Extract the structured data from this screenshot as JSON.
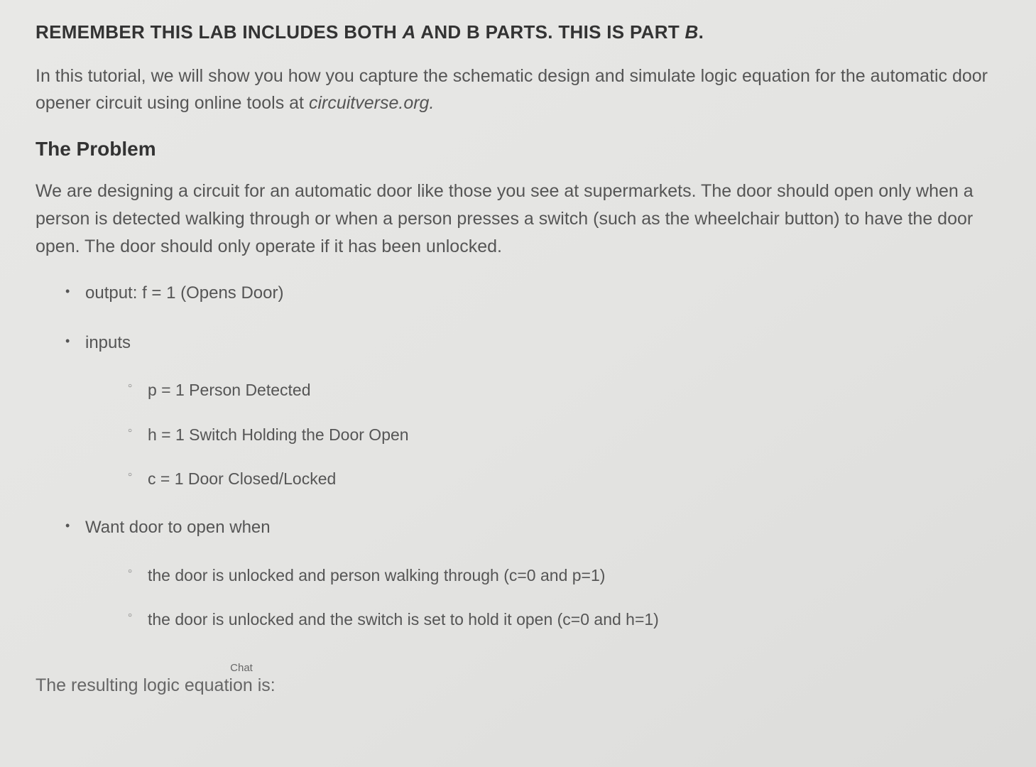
{
  "heading": {
    "prefix": "REMEMBER THIS LAB INCLUDES BOTH ",
    "italic1": "A ",
    "mid": " AND B PARTS. THIS IS PART ",
    "italic2": "B",
    "suffix": "."
  },
  "intro": {
    "text1": "In this tutorial, we will show you how you capture the schematic design and simulate logic equation for the automatic door opener circuit using online tools at ",
    "italic_site": "circuitverse.org.",
    "text2": ""
  },
  "section_title": "The Problem",
  "problem_text": "We are designing a circuit for an automatic door like those you see at supermarkets. The door should open only when a person is detected walking through or when a person presses a switch (such as the wheelchair button) to have the door open. The door should only operate if it has been unlocked.",
  "list": {
    "item1": "output: f = 1 (Opens Door)",
    "item2": "inputs",
    "item2_sub": {
      "a": "p = 1 Person Detected",
      "b": "h = 1 Switch Holding the Door Open",
      "c": "c = 1 Door Closed/Locked"
    },
    "item3": "Want door to open when",
    "item3_sub": {
      "a": "the door is unlocked and person walking through (c=0 and p=1)",
      "b": "the door is unlocked and the switch is set to hold it open (c=0 and h=1)"
    }
  },
  "chat_label": "Chat",
  "final_text": "The resulting logic equation is:"
}
